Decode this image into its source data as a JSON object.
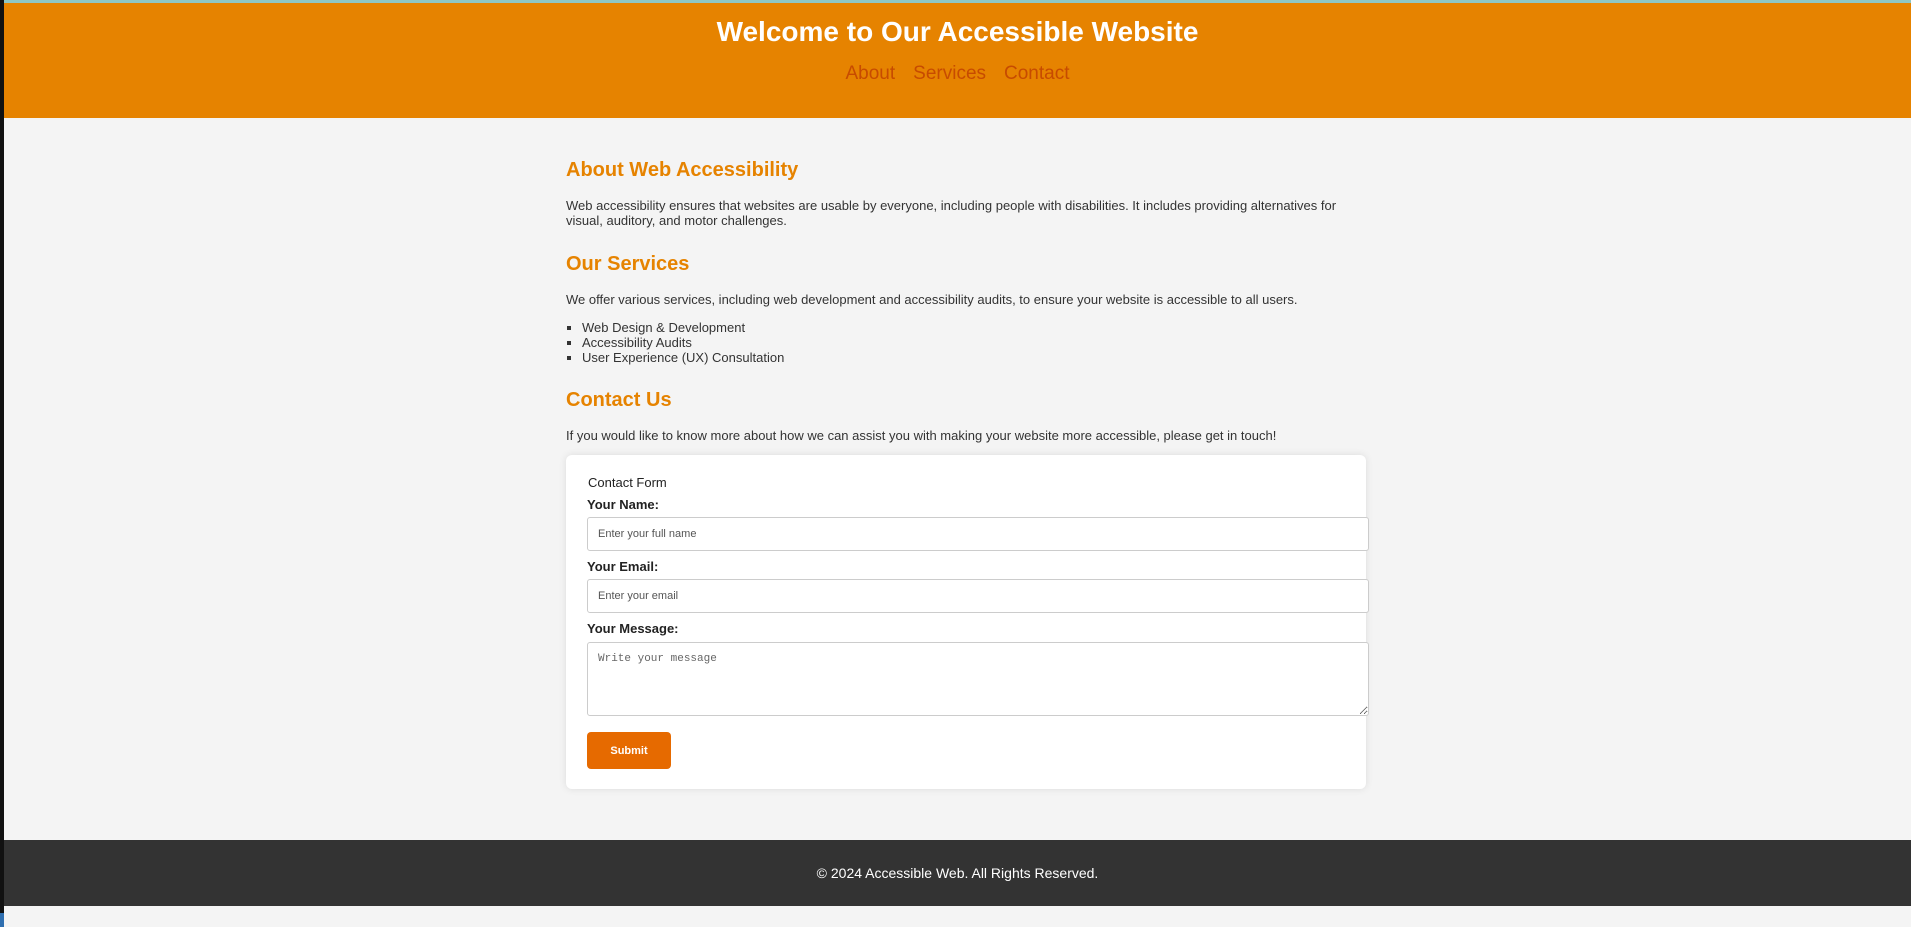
{
  "header": {
    "title": "Welcome to Our Accessible Website",
    "nav": [
      "About",
      "Services",
      "Contact"
    ]
  },
  "about": {
    "heading": "About Web Accessibility",
    "text": "Web accessibility ensures that websites are usable by everyone, including people with disabilities. It includes providing alternatives for visual, auditory, and motor challenges."
  },
  "services": {
    "heading": "Our Services",
    "text": "We offer various services, including web development and accessibility audits, to ensure your website is accessible to all users.",
    "items": [
      "Web Design & Development",
      "Accessibility Audits",
      "User Experience (UX) Consultation"
    ]
  },
  "contact": {
    "heading": "Contact Us",
    "text": "If you would like to know more about how we can assist you with making your website more accessible, please get in touch!"
  },
  "form": {
    "legend": "Contact Form",
    "name_label": "Your Name:",
    "name_placeholder": "Enter your full name",
    "email_label": "Your Email:",
    "email_placeholder": "Enter your email",
    "message_label": "Your Message:",
    "message_placeholder": "Write your message",
    "submit_label": "Submit"
  },
  "footer": {
    "text": "© 2024 Accessible Web. All Rights Reserved."
  },
  "colors": {
    "header_bg": "#e68300",
    "heading": "#e68300",
    "nav_link": "#c74b00",
    "button": "#e66a00",
    "footer_bg": "#333333",
    "page_bg": "#f4f4f4"
  }
}
